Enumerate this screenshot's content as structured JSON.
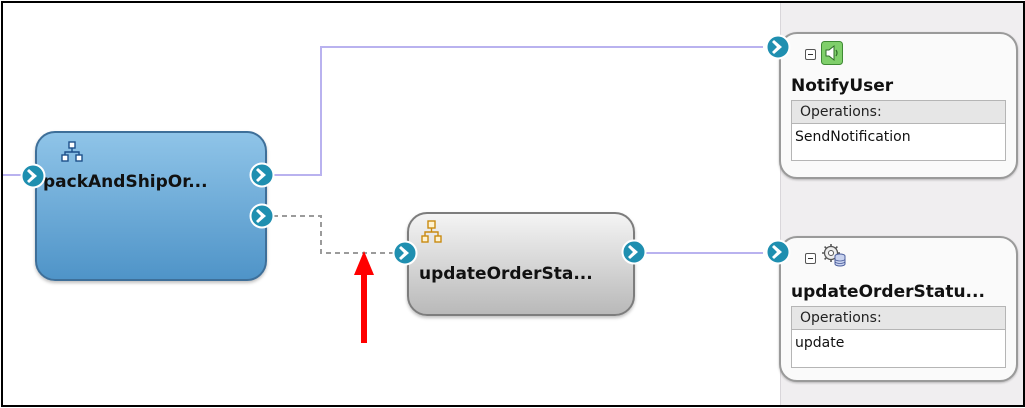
{
  "components": {
    "pack_and_ship": {
      "label": "packAndShipOr..."
    },
    "update_order_status": {
      "label": "updateOrderSta..."
    }
  },
  "references": {
    "notify_user": {
      "title": "NotifyUser",
      "operations_label": "Operations:",
      "operations": [
        "SendNotification"
      ]
    },
    "update_order_status_service": {
      "title": "updateOrderStatu...",
      "operations_label": "Operations:",
      "operations": [
        "update"
      ]
    }
  },
  "icons": {
    "composite": "hierarchy-icon",
    "bpel": "hierarchy-icon-orange",
    "speaker": "speaker-icon",
    "db_adapter": "gear-database-icon",
    "port": "chevron-right-circle-icon"
  },
  "colors": {
    "wire_solid": "#b9b2ef",
    "wire_dashed": "#9b9b9b",
    "annotation_arrow": "#ff0000",
    "component_blue": "#5fa0d2",
    "port_teal": "#1f8fb0"
  }
}
